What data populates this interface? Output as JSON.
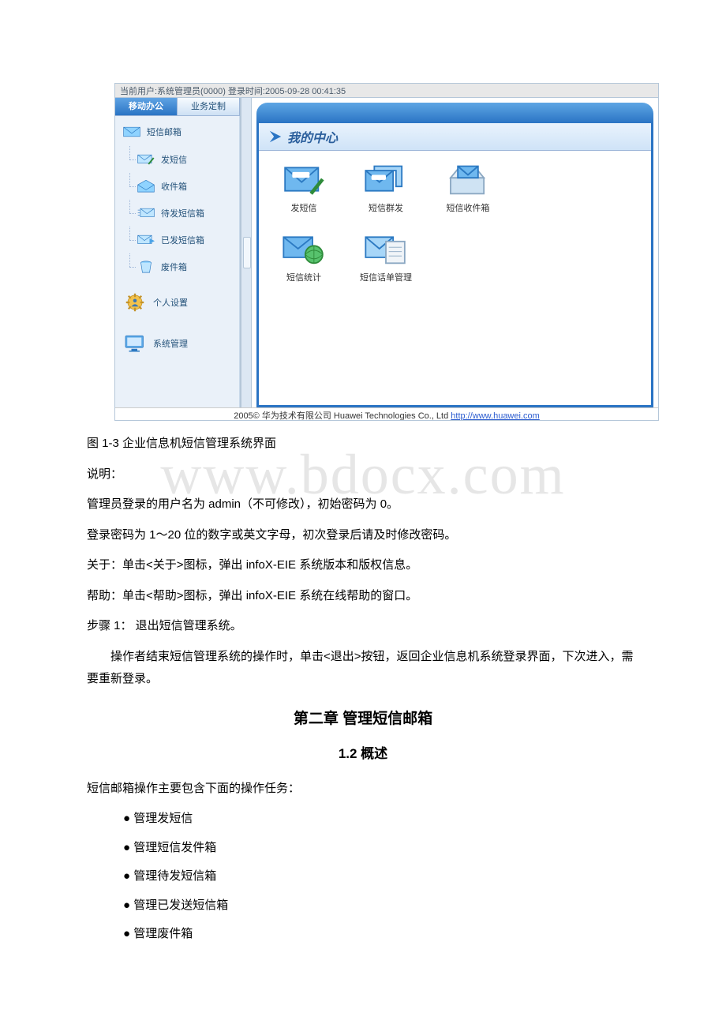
{
  "screenshot": {
    "status_bar": "当前用户:系统管理员(0000) 登录时间:2005-09-28 00:41:35",
    "tabs": {
      "active": "移动办公",
      "inactive": "业务定制"
    },
    "sidebar": {
      "sms_mailbox": "短信邮箱",
      "items": [
        {
          "label": "发短信"
        },
        {
          "label": "收件箱"
        },
        {
          "label": "待发短信箱"
        },
        {
          "label": "已发短信箱"
        },
        {
          "label": "废件箱"
        }
      ],
      "personal_settings": "个人设置",
      "system_management": "系统管理"
    },
    "main": {
      "section_title": "我的中心",
      "grid_row1": [
        {
          "label": "发短信"
        },
        {
          "label": "短信群发"
        },
        {
          "label": "短信收件箱"
        }
      ],
      "grid_row2": [
        {
          "label": "短信统计"
        },
        {
          "label": "短信话单管理"
        }
      ]
    },
    "footer_prefix": "2005© 华为技术有限公司  Huawei Technologies Co., Ltd  ",
    "footer_url": "http://www.huawei.com"
  },
  "doc": {
    "caption": "图 1-3 企业信息机短信管理系统界面",
    "note_label": "说明：",
    "note1": "管理员登录的用户名为 admin（不可修改），初始密码为 0。",
    "note2": "登录密码为 1～20 位的数字或英文字母，初次登录后请及时修改密码。",
    "note3": "关于：单击<关于>图标，弹出 infoX-EIE 系统版本和版权信息。",
    "note4": "帮助：单击<帮助>图标，弹出 infoX-EIE 系统在线帮助的窗口。",
    "step1": "步骤 1： 退出短信管理系统。",
    "para1": "操作者结束短信管理系统的操作时，单击<退出>按钮，返回企业信息机系统登录界面，下次进入，需要重新登录。",
    "chapter_title": "第二章 管理短信邮箱",
    "section_title": "1.2 概述",
    "overview_intro": "短信邮箱操作主要包含下面的操作任务：",
    "bullets": [
      "● 管理发短信",
      "● 管理短信发件箱",
      "● 管理待发短信箱",
      "● 管理已发送短信箱",
      "● 管理废件箱"
    ]
  },
  "watermark": "www.bdocx.com"
}
